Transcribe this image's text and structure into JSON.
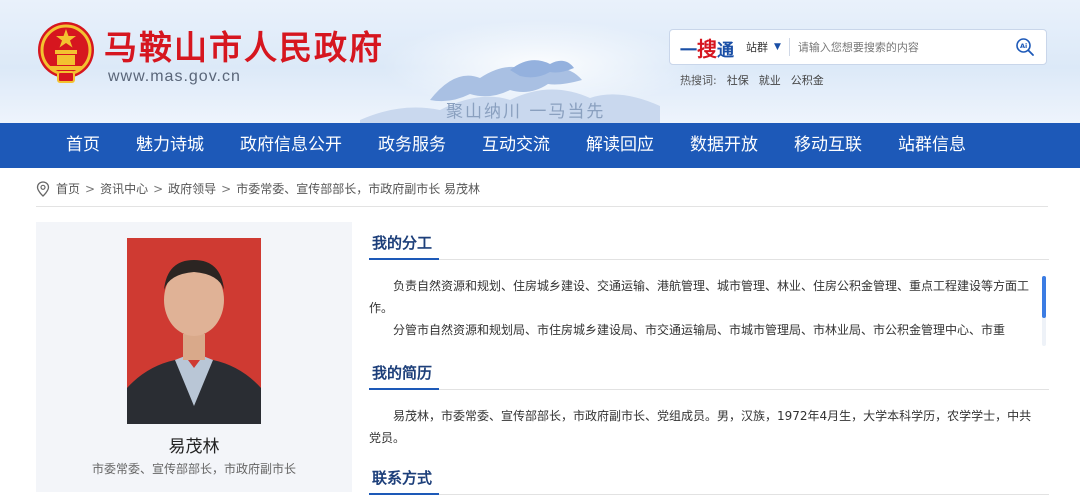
{
  "header": {
    "site_title": "马鞍山市人民政府",
    "site_url": "www.mas.gov.cn",
    "slogan": "聚山纳川 一马当先"
  },
  "search": {
    "brand_a": "一",
    "brand_b": "搜",
    "brand_c": "通",
    "scope": "站群",
    "placeholder": "请输入您想要搜索的内容",
    "hot_label": "热搜词:",
    "hot_words": [
      "社保",
      "就业",
      "公积金"
    ]
  },
  "nav": {
    "items": [
      "首页",
      "魅力诗城",
      "政府信息公开",
      "政务服务",
      "互动交流",
      "解读回应",
      "数据开放",
      "移动互联",
      "站群信息"
    ]
  },
  "breadcrumb": {
    "items": [
      "首页",
      "资讯中心",
      "政府领导",
      "市委常委、宣传部部长，市政府副市长 易茂林"
    ],
    "separator": ">"
  },
  "profile": {
    "name": "易茂林",
    "title": "市委常委、宣传部部长，市政府副市长"
  },
  "sections": {
    "duty_title": "我的分工",
    "duty_p1": "负责自然资源和规划、住房城乡建设、交通运输、港航管理、城市管理、林业、住房公积金管理、重点工程建设等方面工作。",
    "duty_p2": "分管市自然资源和规划局、市住房城乡建设局、市交通运输局、市城市管理局、市林业局、市公积金管理中心、市重",
    "resume_title": "我的简历",
    "resume_p1": "易茂林，市委常委、宣传部部长，市政府副市长、党组成员。男，汉族，1972年4月生，大学本科学历，农学学士，中共党员。",
    "contact_title": "联系方式"
  },
  "colors": {
    "brand_red": "#d6161f",
    "nav_blue": "#1d59b8",
    "heading_blue": "#1d3f7a"
  }
}
